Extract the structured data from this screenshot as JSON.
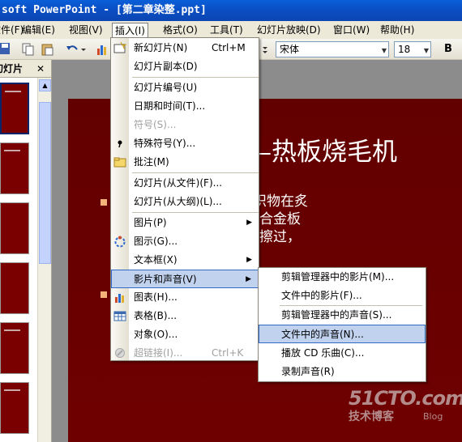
{
  "window": {
    "title": "soft PowerPoint - [第二章染整.ppt]"
  },
  "menubar": {
    "items": [
      {
        "label": "文件(F)"
      },
      {
        "label": "编辑(E)"
      },
      {
        "label": "视图(V)"
      },
      {
        "label": "插入(I)"
      },
      {
        "label": "格式(O)"
      },
      {
        "label": "工具(T)"
      },
      {
        "label": "幻灯片放映(D)"
      },
      {
        "label": "窗口(W)"
      },
      {
        "label": "帮助(H)"
      }
    ]
  },
  "toolbar": {
    "font_name": "宋体",
    "font_size": "18",
    "bold_label": "B"
  },
  "panel": {
    "tab_label": "幻灯片",
    "close_label": "✕"
  },
  "slide": {
    "title": "—热板烧毛机",
    "lines": [
      "织物在炙",
      "合金板",
      "擦过，"
    ]
  },
  "insert_menu": {
    "items": [
      {
        "label": "新幻灯片(N)",
        "shortcut": "Ctrl+M",
        "icon": "new-slide-icon"
      },
      {
        "label": "幻灯片副本(D)"
      },
      {
        "label": "幻灯片编号(U)"
      },
      {
        "label": "日期和时间(T)..."
      },
      {
        "label": "符号(S)...",
        "disabled": true
      },
      {
        "label": "特殊符号(Y)...",
        "icon": "special-symbol-icon"
      },
      {
        "label": "批注(M)",
        "icon": "comment-icon"
      },
      {
        "label": "幻灯片(从文件)(F)..."
      },
      {
        "label": "幻灯片(从大纲)(L)..."
      },
      {
        "label": "图片(P)",
        "submenu": true
      },
      {
        "label": "图示(G)...",
        "icon": "diagram-icon"
      },
      {
        "label": "文本框(X)",
        "submenu": true
      },
      {
        "label": "影片和声音(V)",
        "submenu": true,
        "highlighted": true
      },
      {
        "label": "图表(H)...",
        "icon": "chart-icon"
      },
      {
        "label": "表格(B)...",
        "icon": "table-icon"
      },
      {
        "label": "对象(O)..."
      },
      {
        "label": "超链接(I)...",
        "shortcut": "Ctrl+K",
        "disabled": true,
        "icon": "hyperlink-icon"
      }
    ]
  },
  "movie_sound_menu": {
    "items": [
      {
        "label": "剪辑管理器中的影片(M)..."
      },
      {
        "label": "文件中的影片(F)..."
      },
      {
        "label": "剪辑管理器中的声音(S)..."
      },
      {
        "label": "文件中的声音(N)...",
        "highlighted": true
      },
      {
        "label": "播放 CD 乐曲(C)..."
      },
      {
        "label": "录制声音(R)"
      }
    ]
  },
  "watermark": {
    "line1": "51CTO.com",
    "line2": "技术博客",
    "line3": "Blog"
  },
  "colors": {
    "slide_bg": "#620000",
    "menu_highlight": "#c1d2ee",
    "title_bar": "#0a5fd8"
  }
}
